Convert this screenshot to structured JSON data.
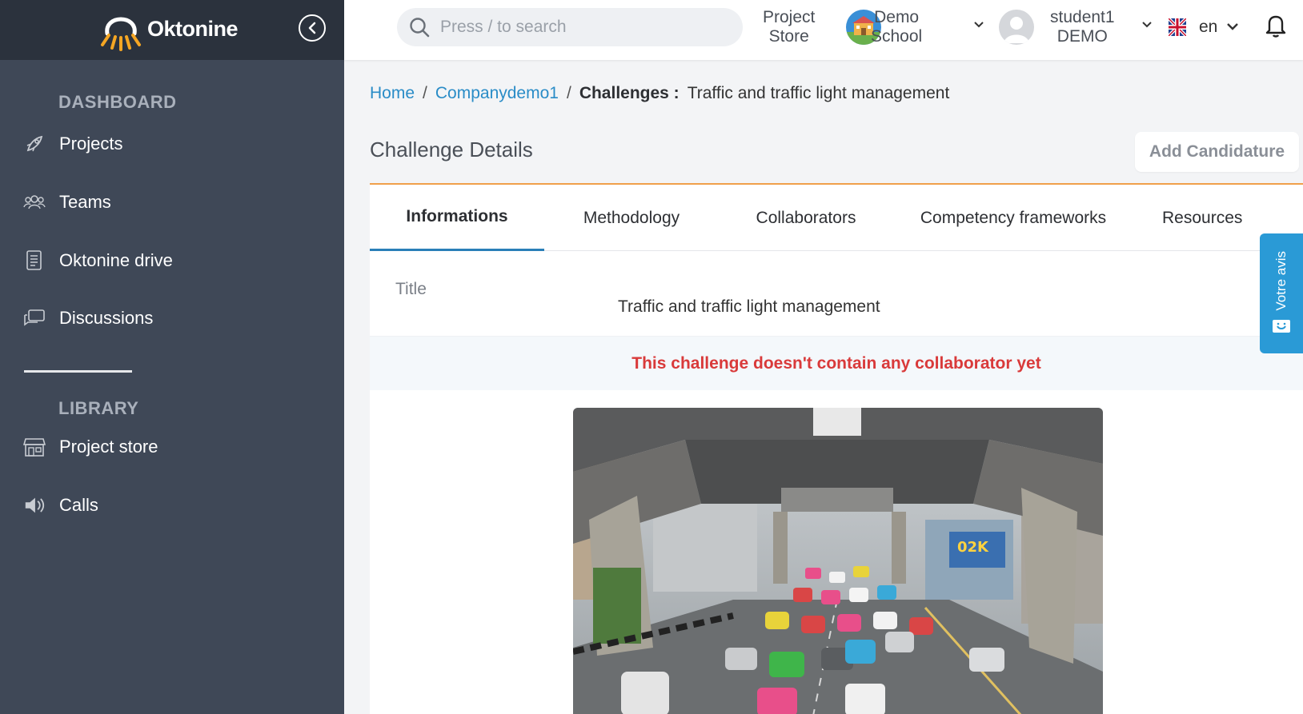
{
  "sidebar": {
    "brand": "Oktonine",
    "sections": [
      {
        "title": "DASHBOARD"
      },
      {
        "title": "LIBRARY"
      }
    ],
    "items": [
      {
        "label": "Projects",
        "icon": "rocket-icon"
      },
      {
        "label": "Teams",
        "icon": "people-icon"
      },
      {
        "label": "Oktonine drive",
        "icon": "document-icon"
      },
      {
        "label": "Discussions",
        "icon": "chat-icon"
      },
      {
        "label": "Project store",
        "icon": "store-icon"
      },
      {
        "label": "Calls",
        "icon": "speaker-icon"
      }
    ]
  },
  "topbar": {
    "search_placeholder": "Press / to search",
    "project_store_line1": "Project",
    "project_store_line2": "Store",
    "school_line1": "Demo",
    "school_line2": "School",
    "user_line1": "student1",
    "user_line2": "DEMO",
    "language": "en"
  },
  "breadcrumb": {
    "home": "Home",
    "company": "Companydemo1",
    "section": "Challenges :",
    "current": "Traffic and traffic light management"
  },
  "page": {
    "title": "Challenge Details",
    "add_button": "Add Candidature"
  },
  "tabs": [
    {
      "label": "Informations",
      "active": true
    },
    {
      "label": "Methodology"
    },
    {
      "label": "Collaborators"
    },
    {
      "label": "Competency frameworks"
    },
    {
      "label": "Resources"
    }
  ],
  "details": {
    "title_label": "Title",
    "title_value": "Traffic and traffic light management",
    "alert": "This challenge doesn't contain any collaborator yet"
  },
  "feedback": {
    "label": "Votre avis"
  },
  "colors": {
    "sidebar_bg": "#3f4857",
    "sidebar_top": "#2b323d",
    "link": "#2a8cc7",
    "accent_orange": "#f0a04b",
    "alert_red": "#d93a3a",
    "feedback_blue": "#2a9ad6"
  }
}
